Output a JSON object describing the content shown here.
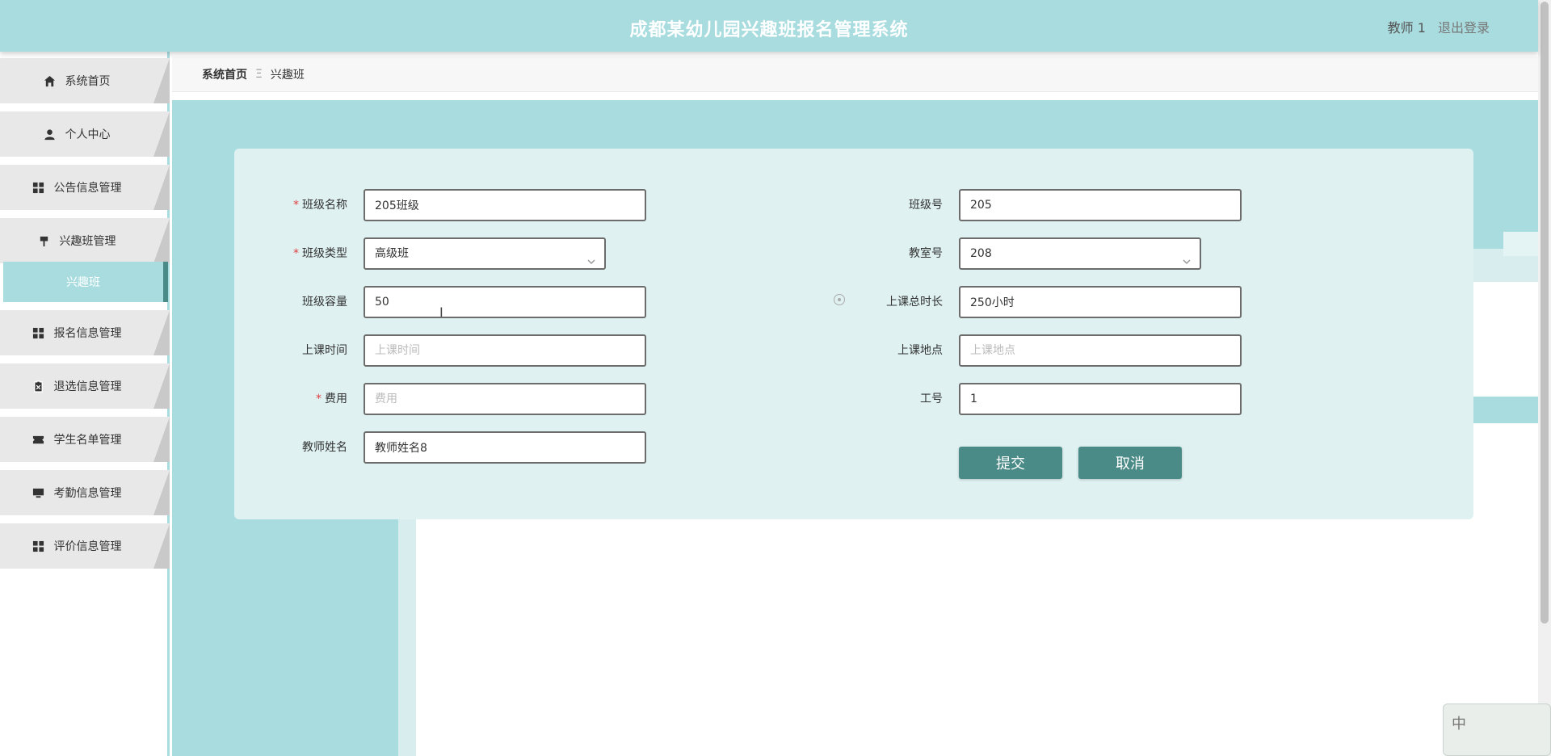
{
  "header": {
    "title": "成都某幼儿园兴趣班报名管理系统",
    "user": "教师 1",
    "logout": "退出登录"
  },
  "sidebar": {
    "items": [
      {
        "label": "系统首页",
        "icon": "home-icon"
      },
      {
        "label": "个人中心",
        "icon": "user-icon"
      },
      {
        "label": "公告信息管理",
        "icon": "grid-icon"
      },
      {
        "label": "兴趣班管理",
        "icon": "flag-icon"
      },
      {
        "label": "报名信息管理",
        "icon": "grid-icon"
      },
      {
        "label": "退选信息管理",
        "icon": "clipboard-icon"
      },
      {
        "label": "学生名单管理",
        "icon": "ticket-icon"
      },
      {
        "label": "考勤信息管理",
        "icon": "monitor-icon"
      },
      {
        "label": "评价信息管理",
        "icon": "grid-icon"
      }
    ],
    "active_sub": "兴趣班"
  },
  "breadcrumb": {
    "home": "系统首页",
    "separator": "Ξ",
    "current": "兴趣班"
  },
  "form": {
    "class_name": {
      "label": "班级名称",
      "value": "205班级",
      "required": true
    },
    "class_no": {
      "label": "班级号",
      "value": "205"
    },
    "class_type": {
      "label": "班级类型",
      "value": "高级班",
      "required": true
    },
    "room_no": {
      "label": "教室号",
      "value": "208"
    },
    "capacity": {
      "label": "班级容量",
      "value": "50"
    },
    "total_hours": {
      "label": "上课总时长",
      "value": "250小时"
    },
    "class_time": {
      "label": "上课时间",
      "placeholder": "上课时间"
    },
    "location": {
      "label": "上课地点",
      "placeholder": "上课地点"
    },
    "fee": {
      "label": "费用",
      "placeholder": "费用",
      "required": true
    },
    "staff_no": {
      "label": "工号",
      "value": "1"
    },
    "teacher_name": {
      "label": "教师姓名",
      "value": "教师姓名8"
    },
    "required_mark": "*",
    "submit": "提交",
    "cancel": "取消"
  },
  "ime": {
    "mode": "中"
  },
  "colors": {
    "teal_light": "#a8dcdf",
    "teal_dark": "#4a8a87",
    "card_bg": "#dff1f1"
  }
}
